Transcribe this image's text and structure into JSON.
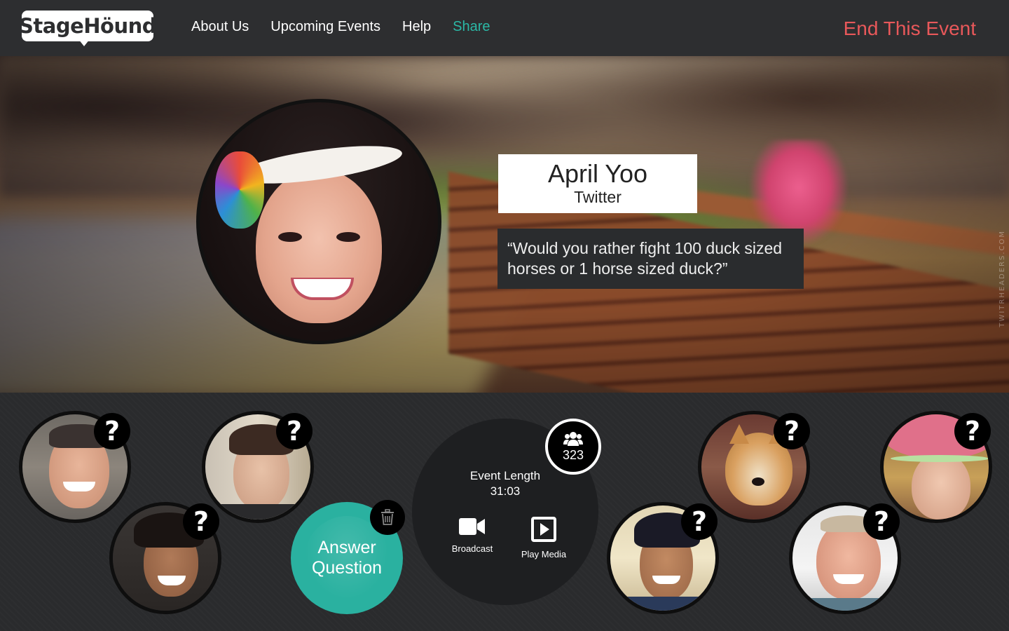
{
  "header": {
    "logo_text": "StageHöund",
    "nav": [
      "About Us",
      "Upcoming Events",
      "Help",
      "Share"
    ],
    "end_event_label": "End This Event"
  },
  "hero": {
    "watermark": "TWITRHEADERS.COM",
    "speaker": {
      "name": "April Yoo",
      "source": "Twitter"
    },
    "question": "“Would you rather fight 100 duck sized horses or 1 horse sized duck?”"
  },
  "stage": {
    "queue": [
      {
        "badge": "?"
      },
      {
        "badge": "?"
      },
      {
        "badge": "?"
      },
      {
        "badge": "?"
      },
      {
        "badge": "?"
      },
      {
        "badge": "?"
      },
      {
        "badge": "?"
      }
    ],
    "answer_label_1": "Answer",
    "answer_label_2": "Question",
    "control": {
      "viewer_count": "323",
      "event_length_label": "Event Length",
      "event_length_value": "31:03",
      "broadcast_label": "Broadcast",
      "play_media_label": "Play Media"
    }
  },
  "colors": {
    "accent_teal": "#2bb8a6",
    "end_event_red": "#e8585a",
    "header_bg": "#2d2e30"
  },
  "icons": [
    "users-icon",
    "video-camera-icon",
    "play-media-icon",
    "trash-icon",
    "question-mark-icon"
  ]
}
